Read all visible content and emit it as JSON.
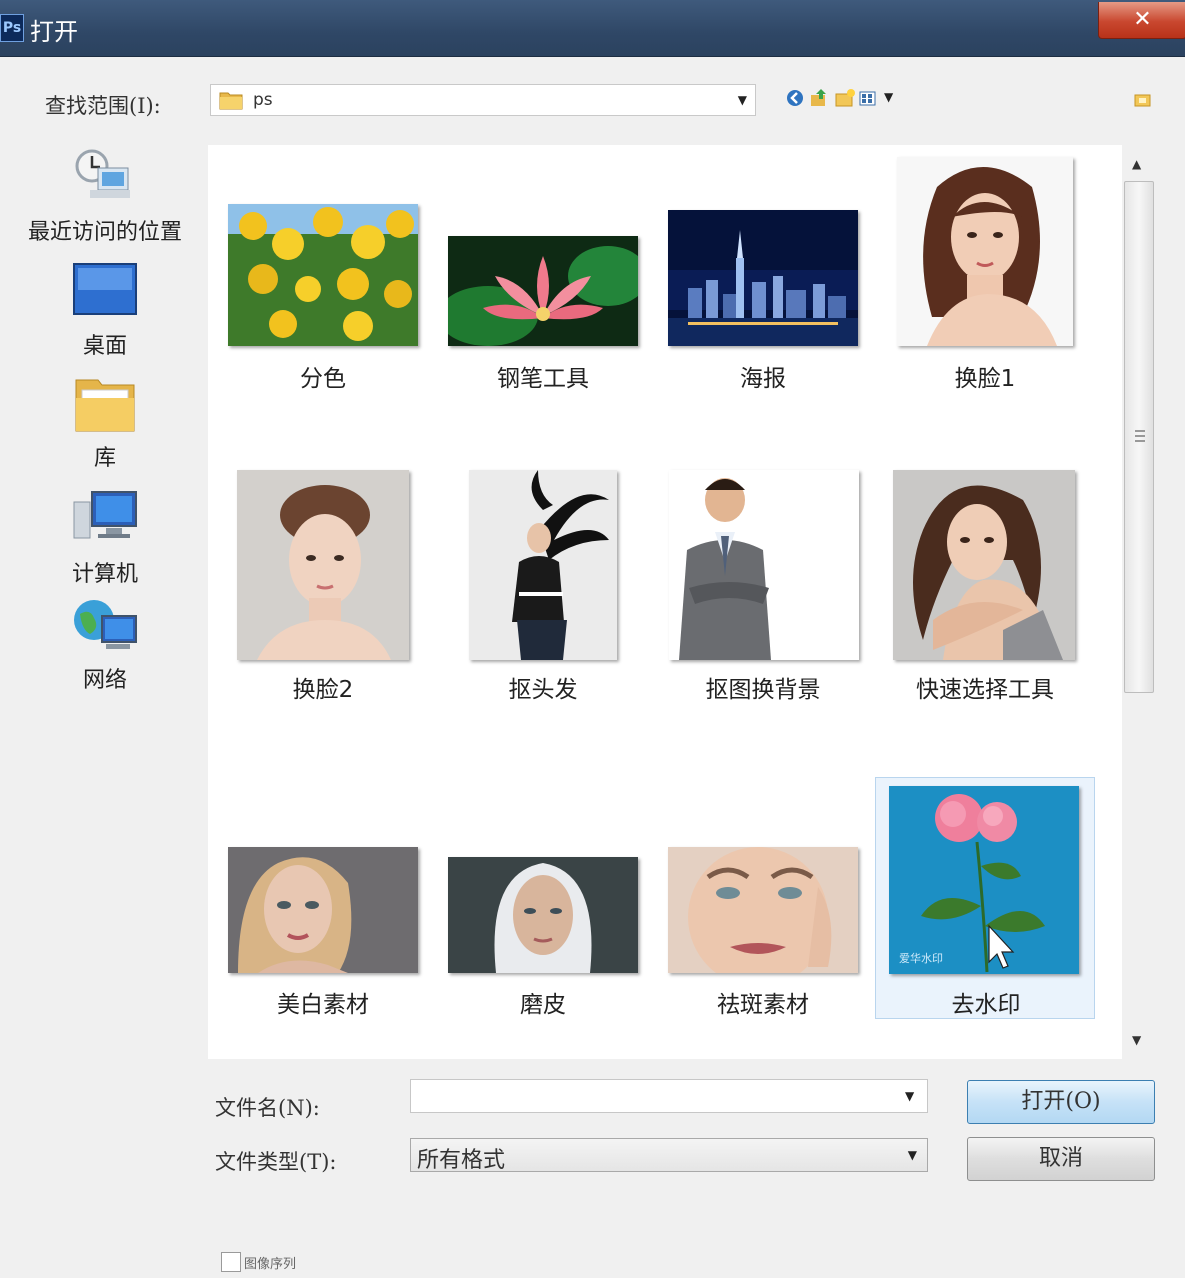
{
  "window": {
    "title": "打开",
    "app_icon": "Ps",
    "close_label": "✕"
  },
  "lookin": {
    "label": "查找范围(I):",
    "value": "ps"
  },
  "toolbar": {
    "icons": [
      "back-icon",
      "up-folder-icon",
      "new-folder-icon",
      "view-menu-icon"
    ]
  },
  "places": [
    {
      "label": "最近访问的位置",
      "icon": "recent-places-icon"
    },
    {
      "label": "桌面",
      "icon": "desktop-icon"
    },
    {
      "label": "库",
      "icon": "libraries-icon"
    },
    {
      "label": "计算机",
      "icon": "computer-icon"
    },
    {
      "label": "网络",
      "icon": "network-icon"
    }
  ],
  "files": [
    {
      "name": "分色",
      "thumb": "yellow-roses"
    },
    {
      "name": "钢笔工具",
      "thumb": "lotus-flower"
    },
    {
      "name": "海报",
      "thumb": "night-city"
    },
    {
      "name": "换脸1",
      "thumb": "woman-portrait"
    },
    {
      "name": "换脸2",
      "thumb": "girl-portrait"
    },
    {
      "name": "抠头发",
      "thumb": "hair-flip"
    },
    {
      "name": "抠图换背景",
      "thumb": "businessman"
    },
    {
      "name": "快速选择工具",
      "thumb": "curly-woman"
    },
    {
      "name": "美白素材",
      "thumb": "blonde-face"
    },
    {
      "name": "磨皮",
      "thumb": "hooded-face"
    },
    {
      "name": "祛斑素材",
      "thumb": "closeup-face"
    },
    {
      "name": "去水印",
      "thumb": "pink-rose",
      "selected": true
    }
  ],
  "form": {
    "filename_label": "文件名(N):",
    "filename_value": "",
    "filetype_label": "文件类型(T):",
    "filetype_value": "所有格式",
    "open_label": "打开(O)",
    "cancel_label": "取消",
    "sequence_label": "图像序列"
  },
  "colors": {
    "titlebar": "#2f4766",
    "close": "#c9472f",
    "selection": "#eaf3fc",
    "open_button_border": "#3c7fb1"
  }
}
